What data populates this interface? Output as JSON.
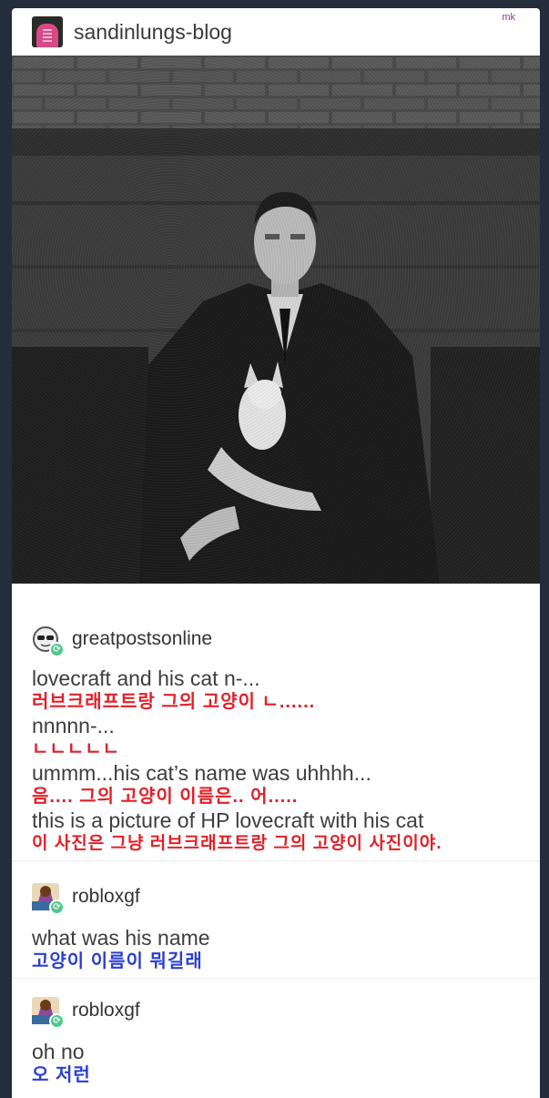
{
  "post": {
    "blog_name": "sandinlungs-blog",
    "watermark": "mk"
  },
  "reblogs": [
    {
      "user": "greatpostsonline",
      "lines": [
        {
          "text": "lovecraft and his cat n-...",
          "lang": "en"
        },
        {
          "text": "러브크래프트랑 그의 고양이 ㄴ......",
          "lang": "ko-red"
        },
        {
          "text": "nnnnn-...",
          "lang": "en"
        },
        {
          "text": "ㄴㄴㄴㄴㄴ",
          "lang": "ko-red"
        },
        {
          "text": "ummm...his cat’s name was uhhhh...",
          "lang": "en"
        },
        {
          "text": "음.... 그의 고양이 이름은.. 어.....",
          "lang": "ko-red"
        },
        {
          "text": "this is a picture of HP lovecraft with his cat",
          "lang": "en"
        },
        {
          "text": "이 사진은 그냥 러브크래프트랑 그의 고양이 사진이야.",
          "lang": "ko-red"
        }
      ]
    },
    {
      "user": "robloxgf",
      "lines": [
        {
          "text": "what was his name",
          "lang": "en"
        },
        {
          "text": "고양이 이름이 뭐길래",
          "lang": "ko-blue"
        }
      ]
    },
    {
      "user": "robloxgf",
      "lines": [
        {
          "text": "oh no",
          "lang": "en"
        },
        {
          "text": "오 저런",
          "lang": "ko-blue"
        }
      ]
    }
  ],
  "colors": {
    "background": "#232d3c",
    "korean_red": "#e21f26",
    "korean_blue": "#2a3fd0",
    "reblog_badge": "#4ec98a"
  },
  "icons": {
    "reblog_badge": "reblog-icon",
    "greatpostsonline_avatar": "sunglasses-face-icon",
    "robloxgf_avatar": "cartoon-character-icon"
  }
}
